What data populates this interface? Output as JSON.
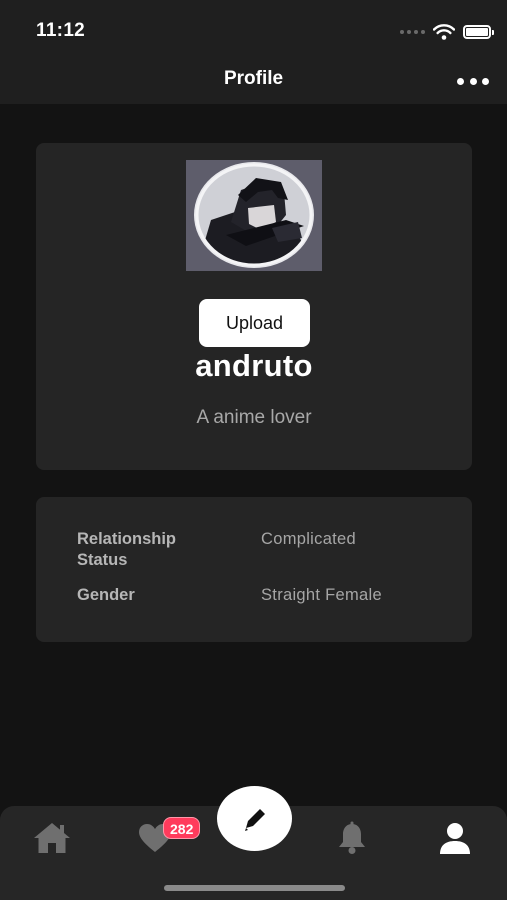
{
  "status_bar": {
    "time": "11:12"
  },
  "header": {
    "title": "Profile",
    "more_icon": "more-horizontal-icon"
  },
  "profile": {
    "avatar_alt": "anime avatar",
    "upload_label": "Upload",
    "username": "andruto",
    "bio": "A anime lover"
  },
  "details": [
    {
      "label": "Relationship Status",
      "value": "Complicated"
    },
    {
      "label": "Gender",
      "value": "Straight Female"
    }
  ],
  "tab_bar": {
    "items": [
      {
        "name": "home",
        "icon": "home-icon"
      },
      {
        "name": "likes",
        "icon": "heart-icon",
        "badge": "282"
      },
      {
        "name": "compose",
        "icon": "pencil-icon"
      },
      {
        "name": "notifications",
        "icon": "bell-icon"
      },
      {
        "name": "profile",
        "icon": "user-icon",
        "active": true
      }
    ]
  },
  "colors": {
    "background": "#131313",
    "card": "#252525",
    "bar": "#1f1f1f",
    "badge": "#ff3b5c",
    "inactive_icon": "#6f6f6f",
    "active_icon": "#ffffff"
  }
}
